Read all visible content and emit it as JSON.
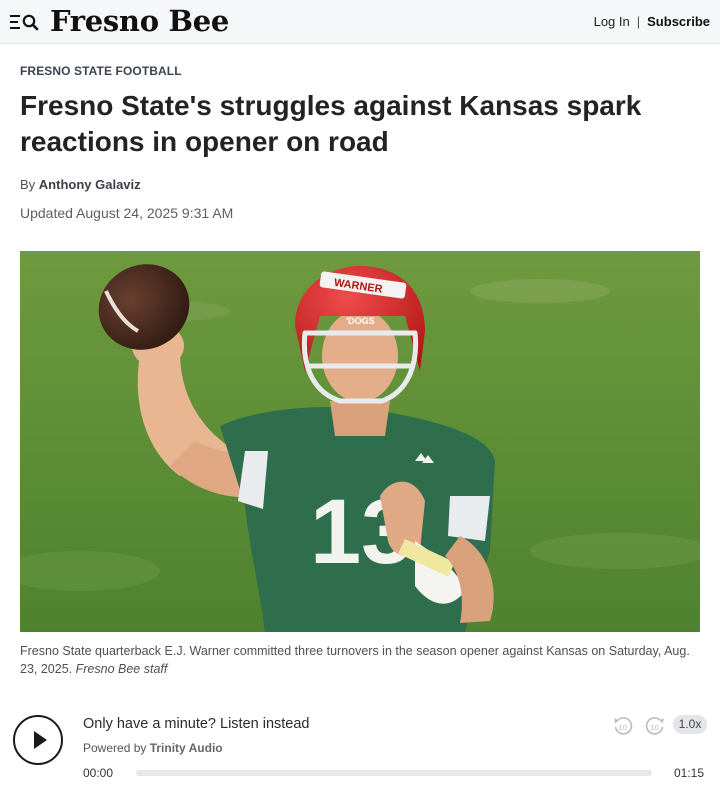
{
  "header": {
    "logo": "Fresno Bee",
    "login_label": "Log In",
    "separator": "|",
    "subscribe_label": "Subscribe"
  },
  "article": {
    "section": "FRESNO STATE FOOTBALL",
    "headline": "Fresno State's struggles against Kansas spark reactions in opener on road",
    "byline_prefix": "By",
    "author": "Anthony Galaviz",
    "updated": "Updated August 24, 2025 9:31 AM",
    "photo": {
      "helmet_text": "WARNER",
      "helmet_front": "'DOGS",
      "jersey_number": "13"
    },
    "caption": "Fresno State quarterback E.J. Warner committed three turnovers in the season opener against Kansas on Saturday, Aug. 23, 2025.",
    "caption_credit": "Fresno Bee staff"
  },
  "audio": {
    "prompt": "Only have a minute? Listen instead",
    "powered_by": "Powered by",
    "provider": "Trinity Audio",
    "rewind_label": "10",
    "forward_label": "10",
    "speed": "1.0x",
    "current_time": "00:00",
    "duration": "01:15",
    "progress": 0
  },
  "icons": {
    "menu": "menu-icon",
    "search": "search-icon",
    "play": "play-icon",
    "rewind": "rewind-10-icon",
    "forward": "forward-10-icon"
  }
}
